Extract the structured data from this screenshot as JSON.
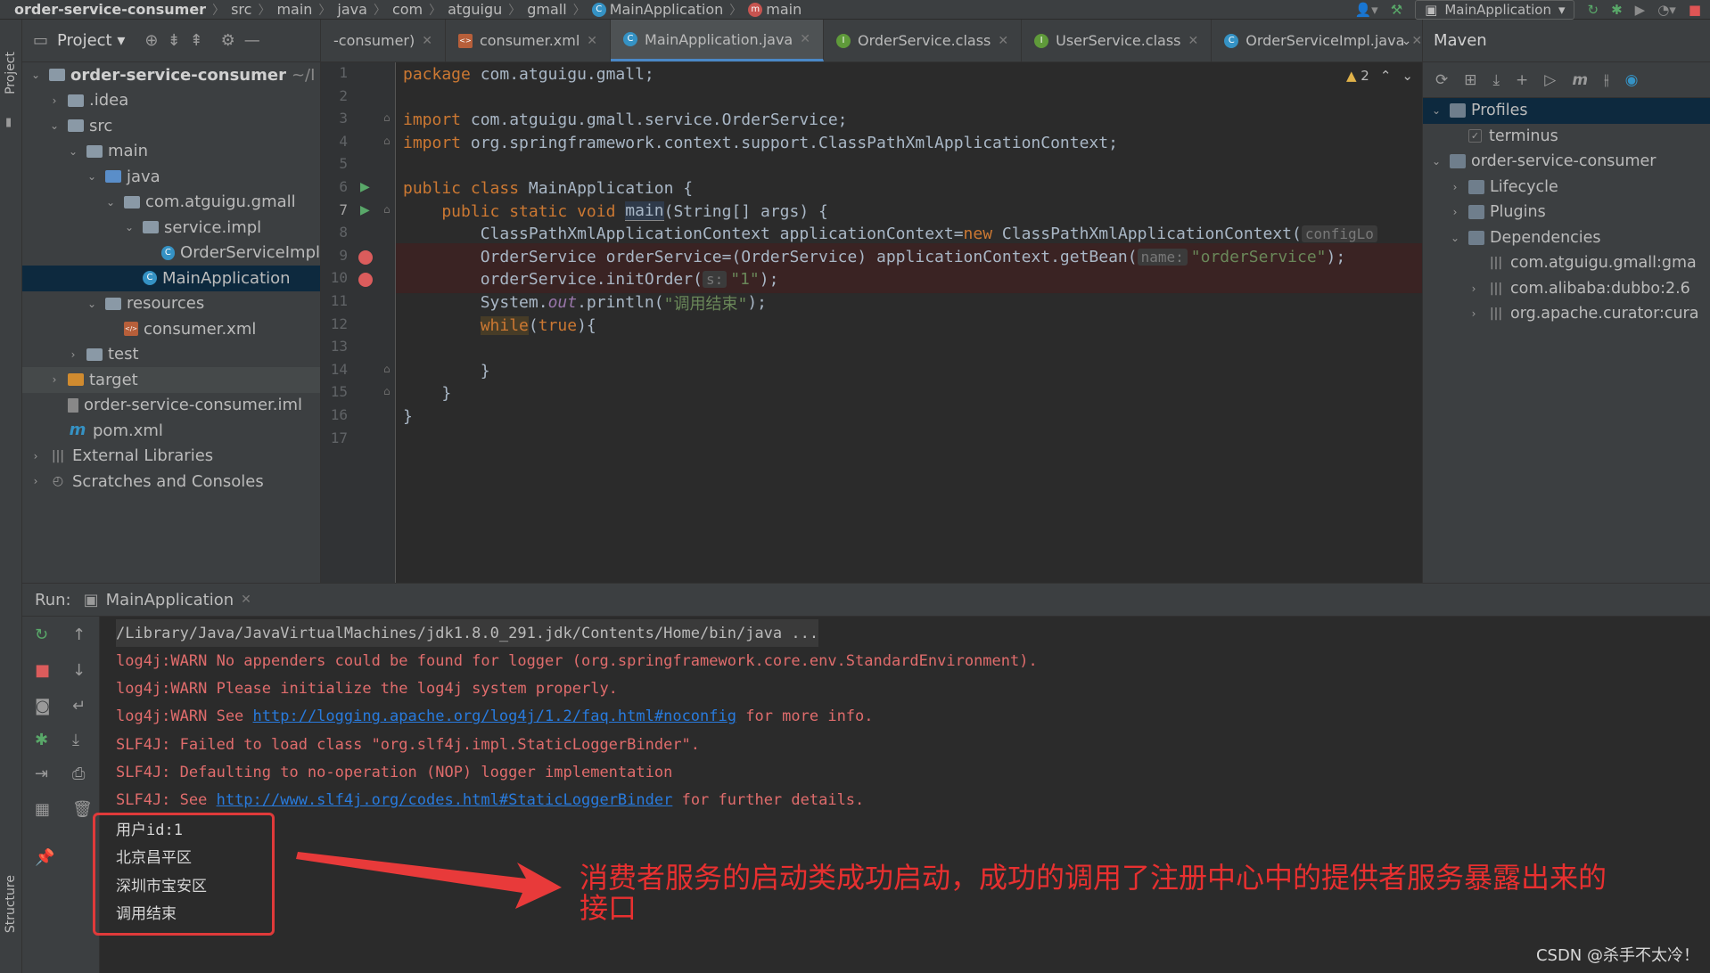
{
  "breadcrumb": [
    "order-service-consumer",
    "src",
    "main",
    "java",
    "com",
    "atguigu",
    "gmall",
    "MainApplication",
    "main"
  ],
  "run_config": "MainApplication",
  "left_strip": {
    "project_label": "Project",
    "structure_label": "Structure"
  },
  "project_panel": {
    "title": "Project",
    "tree": [
      {
        "label": "order-service-consumer",
        "suffix": "~/I",
        "depth": 0,
        "arrow": "open",
        "icon": "folder",
        "bold": true
      },
      {
        "label": ".idea",
        "depth": 1,
        "arrow": "closed",
        "icon": "folder"
      },
      {
        "label": "src",
        "depth": 1,
        "arrow": "open",
        "icon": "folder"
      },
      {
        "label": "main",
        "depth": 2,
        "arrow": "open",
        "icon": "folder"
      },
      {
        "label": "java",
        "depth": 3,
        "arrow": "open",
        "icon": "folder-blue"
      },
      {
        "label": "com.atguigu.gmall",
        "depth": 4,
        "arrow": "open",
        "icon": "package"
      },
      {
        "label": "service.impl",
        "depth": 5,
        "arrow": "open",
        "icon": "package"
      },
      {
        "label": "OrderServiceImpl",
        "depth": 6,
        "arrow": "none",
        "icon": "class"
      },
      {
        "label": "MainApplication",
        "depth": 5,
        "arrow": "none",
        "icon": "class",
        "selected": true
      },
      {
        "label": "resources",
        "depth": 3,
        "arrow": "open",
        "icon": "folder"
      },
      {
        "label": "consumer.xml",
        "depth": 4,
        "arrow": "none",
        "icon": "xml"
      },
      {
        "label": "test",
        "depth": 2,
        "arrow": "closed",
        "icon": "folder"
      },
      {
        "label": "target",
        "depth": 1,
        "arrow": "closed",
        "icon": "folder-orange",
        "highlight": true
      },
      {
        "label": "order-service-consumer.iml",
        "depth": 1,
        "arrow": "none",
        "icon": "iml"
      },
      {
        "label": "pom.xml",
        "depth": 1,
        "arrow": "none",
        "icon": "maven"
      },
      {
        "label": "External Libraries",
        "depth": 0,
        "arrow": "closed",
        "icon": "library"
      },
      {
        "label": "Scratches and Consoles",
        "depth": 0,
        "arrow": "closed",
        "icon": "scratch"
      }
    ]
  },
  "tabs": [
    {
      "label": "-consumer)",
      "icon": "",
      "active": false
    },
    {
      "label": "consumer.xml",
      "icon": "x",
      "active": false
    },
    {
      "label": "MainApplication.java",
      "icon": "c",
      "active": true
    },
    {
      "label": "OrderService.class",
      "icon": "i",
      "active": false
    },
    {
      "label": "UserService.class",
      "icon": "i",
      "active": false
    },
    {
      "label": "OrderServiceImpl.java",
      "icon": "c",
      "active": false
    }
  ],
  "editor": {
    "warnings": "2",
    "lines": [
      "1",
      "2",
      "3",
      "4",
      "5",
      "6",
      "7",
      "8",
      "9",
      "10",
      "11",
      "12",
      "13",
      "14",
      "15",
      "16",
      "17"
    ],
    "code": {
      "l1_kw": "package",
      "l1_rest": " com.atguigu.gmall;",
      "l3_kw": "import",
      "l3_rest": " com.atguigu.gmall.service.OrderService;",
      "l4_kw": "import",
      "l4_rest": " org.springframework.context.support.ClassPathXmlApplicationContext;",
      "l6_kw": "public class",
      "l6_rest": " MainApplication {",
      "l7_kw": "    public static void ",
      "l7_m": "main",
      "l7_rest": "(String[] args) {",
      "l8_a": "        ClassPathXmlApplicationContext applicationContext=",
      "l8_kw": "new",
      "l8_b": " ClassPathXmlApplicationContext(",
      "l8_hint": "configLo",
      "l9_a": "        OrderService orderService=(OrderService) applicationContext.getBean(",
      "l9_hint": "name:",
      "l9_str": "\"orderService\"",
      "l9_b": ");",
      "l10_a": "        orderService.initOrder(",
      "l10_hint": "s:",
      "l10_str": "\"1\"",
      "l10_b": ");",
      "l11_a": "        System.",
      "l11_i": "out",
      "l11_b": ".println(",
      "l11_str": "\"调用结束\"",
      "l11_c": ");",
      "l12_pad": "        ",
      "l12_kw": "while",
      "l12_a": "(",
      "l12_kw2": "true",
      "l12_b": "){",
      "l14": "        }",
      "l15": "    }",
      "l16": "}"
    }
  },
  "maven": {
    "title": "Maven",
    "tree": [
      {
        "label": "Profiles",
        "depth": 0,
        "arrow": "open",
        "selected": true
      },
      {
        "label": "terminus",
        "depth": 1,
        "arrow": "none",
        "checkbox": true
      },
      {
        "label": "order-service-consumer",
        "depth": 0,
        "arrow": "open"
      },
      {
        "label": "Lifecycle",
        "depth": 1,
        "arrow": "closed"
      },
      {
        "label": "Plugins",
        "depth": 1,
        "arrow": "closed"
      },
      {
        "label": "Dependencies",
        "depth": 1,
        "arrow": "open"
      },
      {
        "label": "com.atguigu.gmall:gma",
        "depth": 2,
        "arrow": "none"
      },
      {
        "label": "com.alibaba:dubbo:2.6",
        "depth": 2,
        "arrow": "closed"
      },
      {
        "label": "org.apache.curator:cura",
        "depth": 2,
        "arrow": "closed"
      }
    ]
  },
  "run": {
    "label": "Run:",
    "tab": "MainApplication",
    "console": [
      {
        "text": "/Library/Java/JavaVirtualMachines/jdk1.8.0_291.jdk/Contents/Home/bin/java ...",
        "style": "gray"
      },
      {
        "text": "log4j:WARN No appenders could be found for logger (org.springframework.core.env.StandardEnvironment).",
        "style": "red"
      },
      {
        "text": "log4j:WARN Please initialize the log4j system properly.",
        "style": "red"
      },
      {
        "pre": "log4j:WARN See ",
        "link": "http://logging.apache.org/log4j/1.2/faq.html#noconfig",
        "post": " for more info.",
        "style": "red"
      },
      {
        "text": "SLF4J: Failed to load class \"org.slf4j.impl.StaticLoggerBinder\".",
        "style": "red"
      },
      {
        "text": "SLF4J: Defaulting to no-operation (NOP) logger implementation",
        "style": "red"
      },
      {
        "pre": "SLF4J: See ",
        "link": "http://www.slf4j.org/codes.html#StaticLoggerBinder",
        "post": " for further details.",
        "style": "red"
      },
      {
        "text": "用户id:1",
        "style": "white"
      },
      {
        "text": "北京昌平区",
        "style": "white"
      },
      {
        "text": "深圳市宝安区",
        "style": "white"
      },
      {
        "text": "调用结束",
        "style": "white"
      }
    ]
  },
  "annotation": "消费者服务的启动类成功启动，成功的调用了注册中心中的提供者服务暴露出来的接口",
  "watermark": "CSDN @杀手不太冷！"
}
